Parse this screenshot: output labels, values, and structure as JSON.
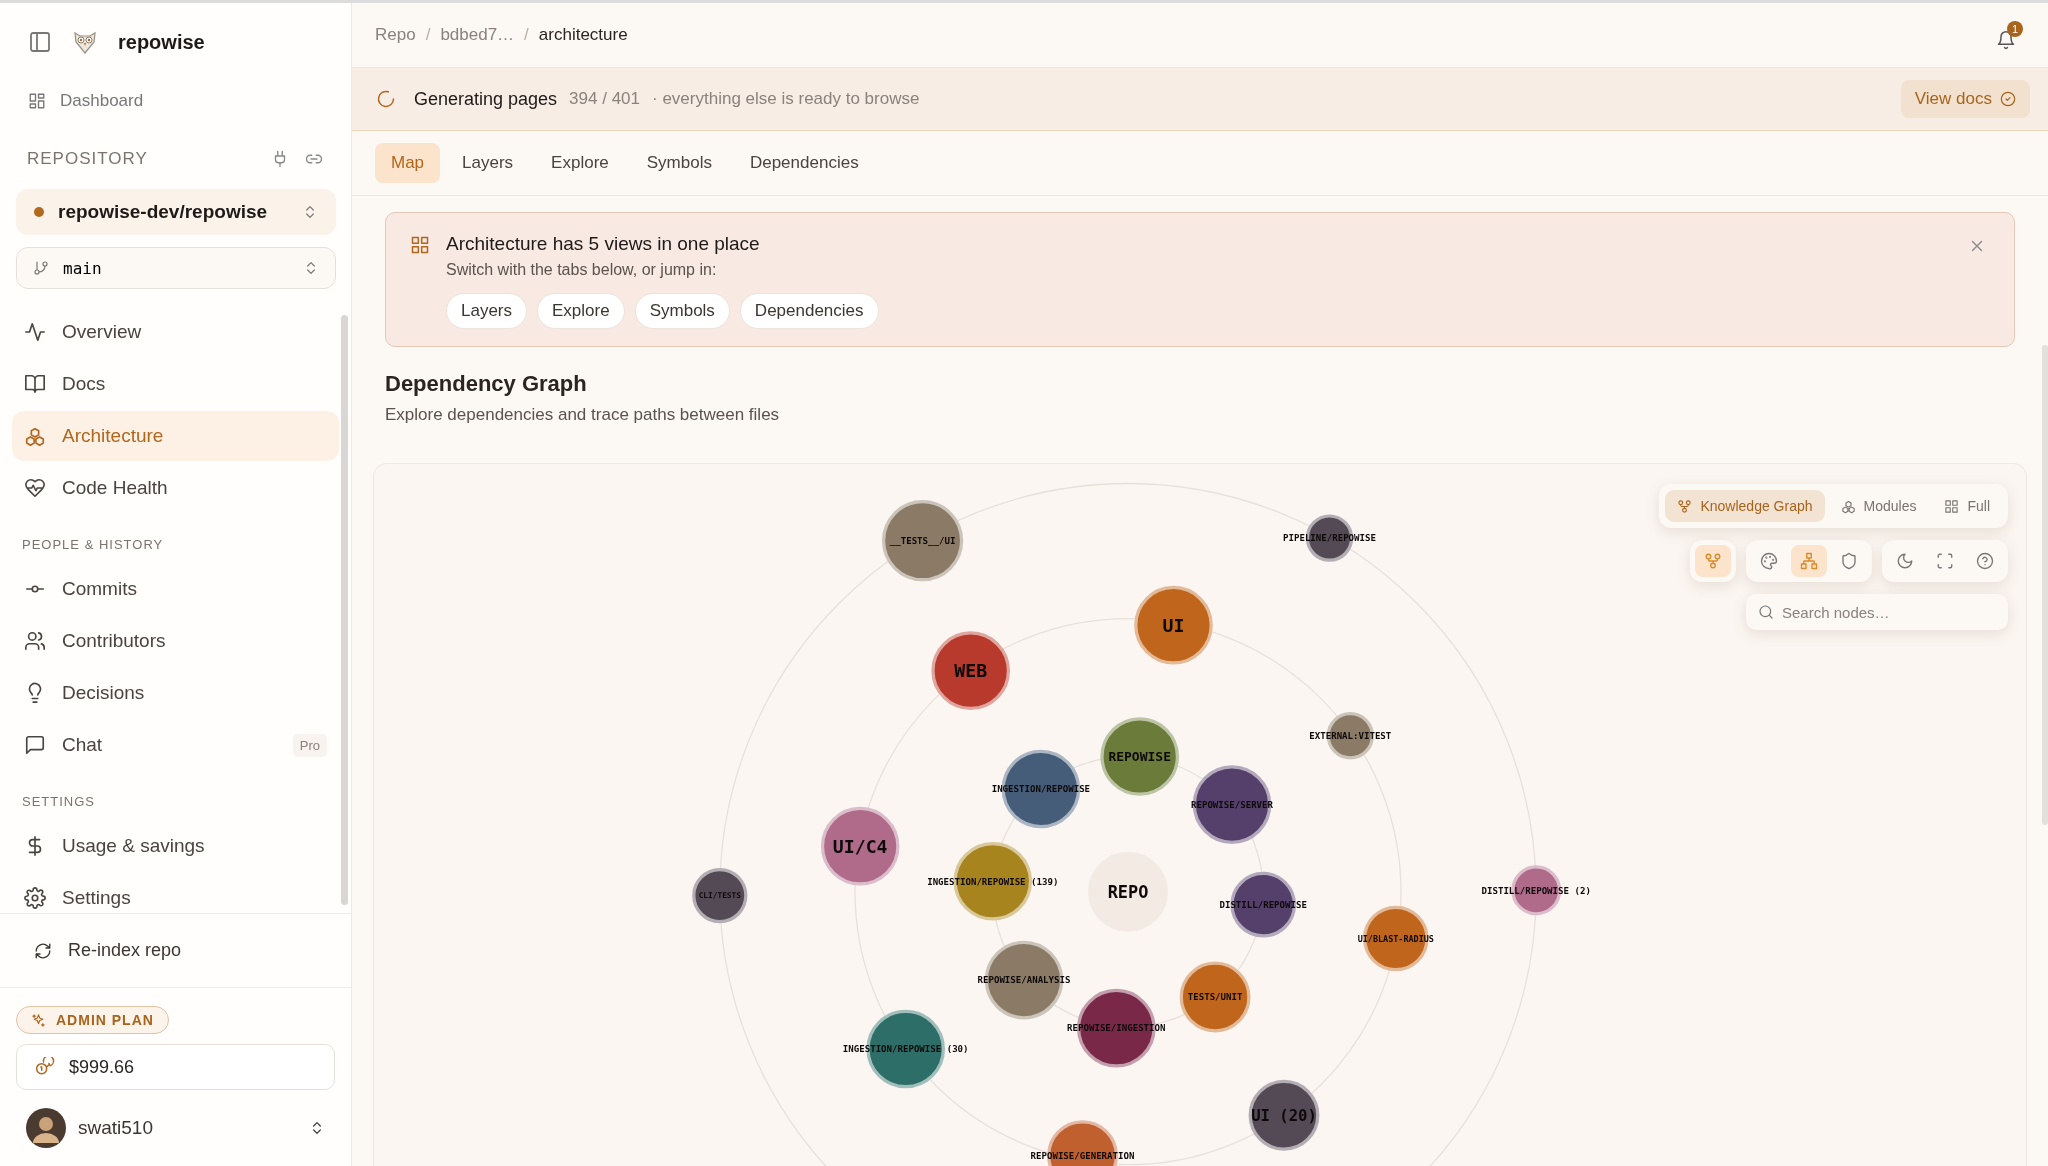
{
  "sidebar": {
    "brand": "repowise",
    "dashboard": "Dashboard",
    "repository_heading": "REPOSITORY",
    "repo": "repowise-dev/repowise",
    "branch": "main",
    "nav_groups": [
      {
        "items": [
          {
            "label": "Overview",
            "selected": false
          },
          {
            "label": "Docs",
            "selected": false
          },
          {
            "label": "Architecture",
            "selected": true
          },
          {
            "label": "Code Health",
            "selected": false
          }
        ]
      },
      {
        "heading": "PEOPLE & HISTORY",
        "items": [
          {
            "label": "Commits",
            "selected": false
          },
          {
            "label": "Contributors",
            "selected": false
          },
          {
            "label": "Decisions",
            "selected": false
          },
          {
            "label": "Chat",
            "selected": false,
            "badge": "Pro"
          }
        ]
      },
      {
        "heading": "SETTINGS",
        "items": [
          {
            "label": "Usage & savings",
            "selected": false
          },
          {
            "label": "Settings",
            "selected": false
          }
        ]
      }
    ],
    "reindex": "Re-index repo",
    "plan": "ADMIN PLAN",
    "balance": "$999.66",
    "user": "swati510"
  },
  "breadcrumb": [
    {
      "kind": "link",
      "text": "Repo"
    },
    {
      "kind": "separator",
      "text": "/"
    },
    {
      "kind": "link",
      "text": "bdbed7…"
    },
    {
      "kind": "separator",
      "text": "/"
    },
    {
      "kind": "current",
      "text": "architecture"
    }
  ],
  "notifications": {
    "count": "1"
  },
  "progress_bar": {
    "title": "Generating pages",
    "count": "394 / 401",
    "note": "· everything else is ready to browse",
    "button": "View docs"
  },
  "tabs": [
    {
      "label": "Map",
      "selected": true
    },
    {
      "label": "Layers",
      "selected": false
    },
    {
      "label": "Explore",
      "selected": false
    },
    {
      "label": "Symbols",
      "selected": false
    },
    {
      "label": "Dependencies",
      "selected": false
    }
  ],
  "banner": {
    "title": "Architecture has 5 views in one place",
    "subtitle": "Switch with the tabs below, or jump in:",
    "links": [
      "Layers",
      "Explore",
      "Symbols",
      "Dependencies"
    ]
  },
  "section": {
    "title": "Dependency Graph",
    "subtitle": "Explore dependencies and trace paths between files"
  },
  "graph": {
    "view_modes": [
      {
        "label": "Knowledge Graph",
        "selected": true
      },
      {
        "label": "Modules",
        "selected": false
      },
      {
        "label": "Full",
        "selected": false
      }
    ],
    "tool_groups": [
      [
        {
          "selected": true
        }
      ],
      [
        {
          "selected": false
        },
        {
          "selected": true
        },
        {
          "selected": false
        }
      ],
      [
        {
          "selected": false
        },
        {
          "selected": false
        },
        {
          "selected": false
        }
      ]
    ],
    "search": {
      "placeholder": "Search nodes…"
    },
    "nodes": [
      {
        "label": "__TESTS__/UI",
        "color": "#8b7b66"
      },
      {
        "label": "PIPELINE/REPOWISE",
        "color": "#544a55"
      },
      {
        "label": "UI",
        "color": "#c0661c"
      },
      {
        "label": "WEB",
        "color": "#b83a2c"
      },
      {
        "label": "EXTERNAL:VITEST",
        "color": "#8b7b66"
      },
      {
        "label": "REPOWISE",
        "color": "#6b7b3a"
      },
      {
        "label": "INGESTION/REPOWISE",
        "color": "#465d7a"
      },
      {
        "label": "REPOWISE/SERVER",
        "color": "#553f6b"
      },
      {
        "label": "UI/C4",
        "color": "#b06b8a"
      },
      {
        "label": "INGESTION/REPOWISE (139)",
        "color": "#a8841f"
      },
      {
        "label": "REPO",
        "color": "#f3ebe3"
      },
      {
        "label": "DISTILL/REPOWISE",
        "color": "#553f6b"
      },
      {
        "label": "CLI/TESTS",
        "color": "#544a55"
      },
      {
        "label": "DISTILL/REPOWISE (2)",
        "color": "#b06b8a"
      },
      {
        "label": "UI/BLAST-RADIUS",
        "color": "#c0661c"
      },
      {
        "label": "REPOWISE/ANALYSIS",
        "color": "#8b7b66"
      },
      {
        "label": "TESTS/UNIT",
        "color": "#c0661c"
      },
      {
        "label": "REPOWISE/INGESTION",
        "color": "#7a2848"
      },
      {
        "label": "INGESTION/REPOWISE (30)",
        "color": "#2e6e68"
      },
      {
        "label": "UI (20)",
        "color": "#544a55"
      },
      {
        "label": "REPOWISE/GENERATION",
        "color": "#c0602f"
      }
    ]
  }
}
